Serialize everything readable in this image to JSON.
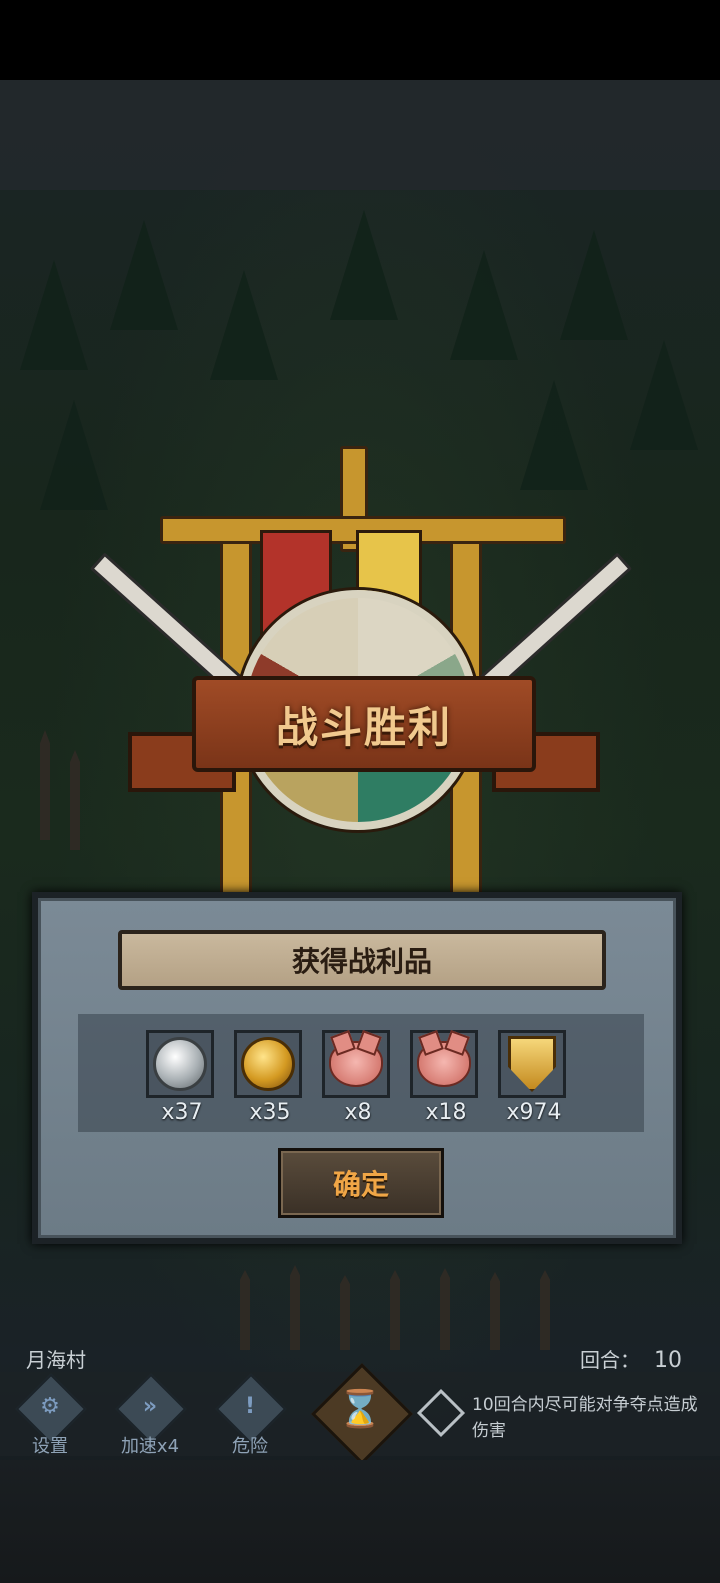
{
  "victory": {
    "title": "战斗胜利"
  },
  "loot_dialog": {
    "header": "获得战利品",
    "items": [
      {
        "icon": "silver-coin-icon",
        "qty": "x37"
      },
      {
        "icon": "gold-coin-icon",
        "qty": "x35"
      },
      {
        "icon": "pig-icon",
        "qty": "x8"
      },
      {
        "icon": "pig-icon",
        "qty": "x18"
      },
      {
        "icon": "shield-crest-icon",
        "qty": "x974"
      }
    ],
    "confirm_label": "确定"
  },
  "hud": {
    "location": "月海村",
    "round_label": "回合：",
    "round_value": "10",
    "buttons": [
      {
        "glyph": "⚙",
        "label": "设置"
      },
      {
        "glyph": "»",
        "label": "加速x4"
      },
      {
        "glyph": "!",
        "label": "危险"
      }
    ],
    "hourglass": "⌛",
    "objective": "10回合内尽可能对争夺点造成伤害"
  },
  "colors": {
    "banner": "#a04b26",
    "title_text": "#f1c98e",
    "confirm_text": "#f0a646",
    "dialog_bg": "#7b8a96"
  }
}
